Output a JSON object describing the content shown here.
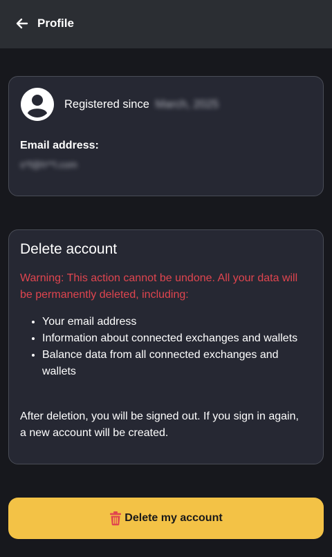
{
  "header": {
    "back_icon": "arrow-left-icon",
    "title": "Profile"
  },
  "profile": {
    "avatar_icon": "user-avatar-icon",
    "registered_label": "Registered since",
    "registered_date": "March, 2025",
    "email_label": "Email address:",
    "email_value": "s*f@h**l.com"
  },
  "delete_section": {
    "title": "Delete account",
    "warning": "Warning: This action cannot be undone. All your data will be permanently deleted, including:",
    "items": [
      "Your email address",
      "Information about connected exchanges and wallets",
      "Balance data from all connected exchanges and wallets"
    ],
    "after_note": "After deletion, you will be signed out. If you sign in again, a new account will be created."
  },
  "delete_button": {
    "icon": "trash-icon",
    "label": "Delete my account"
  },
  "colors": {
    "header_bg": "#2b2e33",
    "page_bg": "#17181d",
    "card_bg": "#262833",
    "warning": "#e0454f",
    "button_bg": "#f3c246",
    "trash": "#e0454f"
  }
}
